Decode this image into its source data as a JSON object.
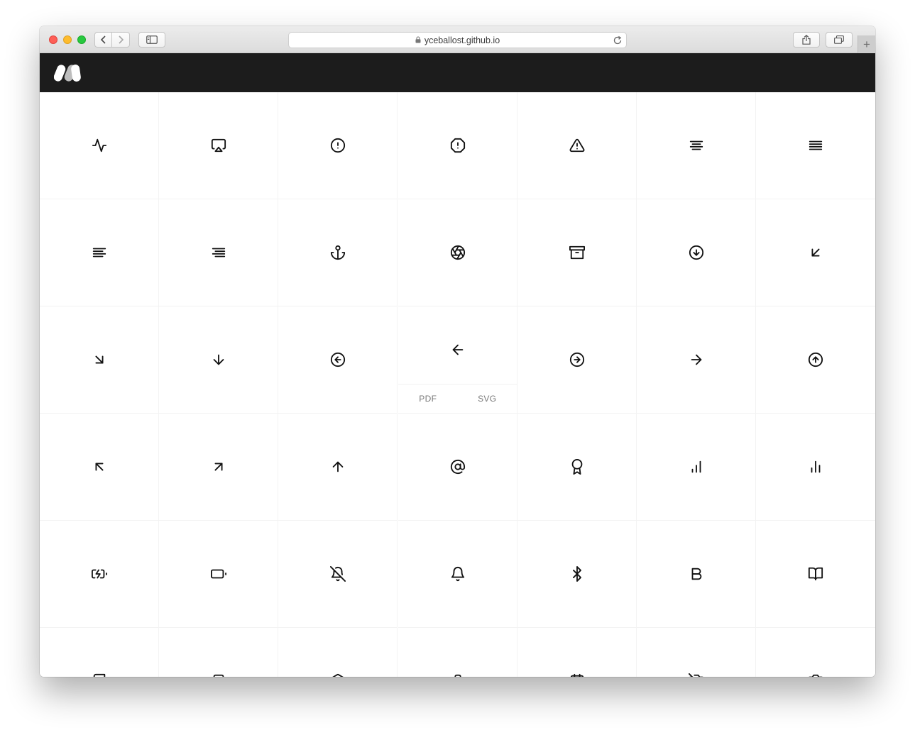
{
  "browser": {
    "url": "yceballost.github.io",
    "new_tab_label": "+",
    "toolbar_icons": [
      "back-icon",
      "forward-icon",
      "sidebar-icon",
      "share-icon",
      "tabs-icon",
      "lock-icon",
      "reload-icon"
    ]
  },
  "site": {
    "logo_icon": "logo-icon",
    "header_color": "#1c1c1c"
  },
  "icon_grid": {
    "hovered_icon": "arrow-left",
    "download_links": [
      "PDF",
      "SVG"
    ],
    "icons": [
      "activity",
      "airplay",
      "alert-circle",
      "alert-octagon",
      "alert-triangle",
      "align-center",
      "align-justify",
      "align-left",
      "align-right",
      "anchor",
      "aperture",
      "archive",
      "arrow-down-circle",
      "arrow-down-left",
      "arrow-down-right",
      "arrow-down",
      "arrow-left-circle",
      "arrow-left",
      "arrow-right-circle",
      "arrow-right",
      "arrow-up-circle",
      "arrow-up-left",
      "arrow-up-right",
      "arrow-up",
      "at-sign",
      "award",
      "bar-chart",
      "bar-chart-2",
      "battery-charging",
      "battery",
      "bell-off",
      "bell",
      "bluetooth",
      "bold",
      "book-open",
      "book",
      "bookmark",
      "box",
      "briefcase",
      "calendar",
      "camera-off",
      "camera"
    ]
  }
}
